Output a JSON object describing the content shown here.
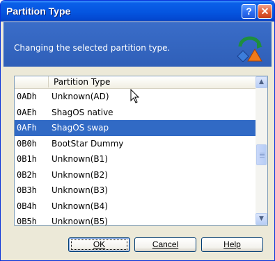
{
  "window": {
    "title": "Partition Type",
    "help_glyph": "?",
    "close_glyph": "✕"
  },
  "banner": {
    "text": "Changing the selected partition type.",
    "icon": "partition-type-icon"
  },
  "list": {
    "header": "Partition Type",
    "rows": [
      {
        "code": "0ADh",
        "name": "Unknown(AD)"
      },
      {
        "code": "0AEh",
        "name": "ShagOS native"
      },
      {
        "code": "0AFh",
        "name": "ShagOS swap",
        "selected": true
      },
      {
        "code": "0B0h",
        "name": "BootStar Dummy"
      },
      {
        "code": "0B1h",
        "name": "Unknown(B1)"
      },
      {
        "code": "0B2h",
        "name": "Unknown(B2)"
      },
      {
        "code": "0B3h",
        "name": "Unknown(B3)"
      },
      {
        "code": "0B4h",
        "name": "Unknown(B4)"
      },
      {
        "code": "0B5h",
        "name": "Unknown(B5)"
      }
    ],
    "selected_index": 2
  },
  "buttons": {
    "ok": "OK",
    "cancel": "Cancel",
    "help": "Help"
  },
  "colors": {
    "title_bar": "#0555E0",
    "banner": "#3A6DC9",
    "selection": "#316AC5"
  }
}
